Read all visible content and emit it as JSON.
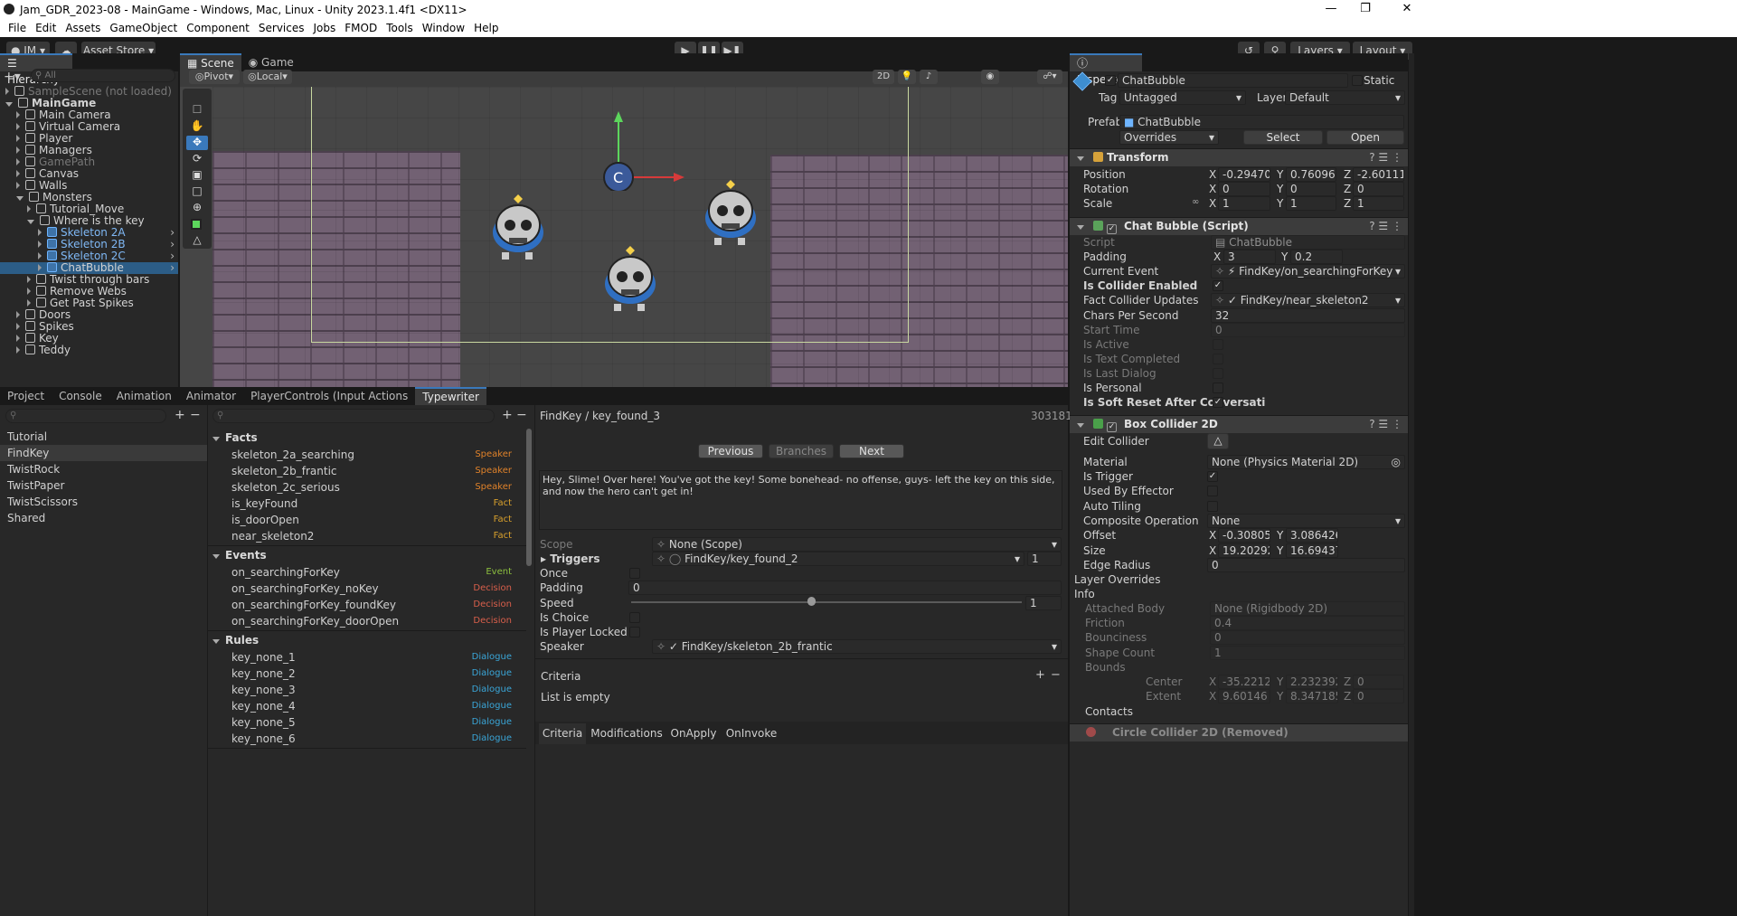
{
  "window": {
    "title": "Jam_GDR_2023-08 - MainGame - Windows, Mac, Linux - Unity 2023.1.4f1 <DX11>"
  },
  "menu": [
    "File",
    "Edit",
    "Assets",
    "GameObject",
    "Component",
    "Services",
    "Jobs",
    "FMOD",
    "Tools",
    "Window",
    "Help"
  ],
  "toolbar": {
    "account": "JM",
    "asset_store": "Asset Store",
    "layers": "Layers",
    "layout": "Layout"
  },
  "hierarchy": {
    "tab": "Hierarchy",
    "search_placeholder": "All",
    "items": [
      {
        "label": "SampleScene (not loaded)",
        "depth": 0,
        "dim": true
      },
      {
        "label": "MainGame",
        "depth": 0,
        "bold": true
      },
      {
        "label": "Main Camera",
        "depth": 1
      },
      {
        "label": "Virtual Camera",
        "depth": 1
      },
      {
        "label": "Player",
        "depth": 1
      },
      {
        "label": "Managers",
        "depth": 1
      },
      {
        "label": "GamePath",
        "depth": 1,
        "dim": true
      },
      {
        "label": "Canvas",
        "depth": 1
      },
      {
        "label": "Walls",
        "depth": 1
      },
      {
        "label": "Monsters",
        "depth": 1
      },
      {
        "label": "Tutorial_Move",
        "depth": 2
      },
      {
        "label": "Where is the key",
        "depth": 2
      },
      {
        "label": "Skeleton 2A",
        "depth": 3,
        "prefab": true
      },
      {
        "label": "Skeleton 2B",
        "depth": 3,
        "prefab": true
      },
      {
        "label": "Skeleton 2C",
        "depth": 3,
        "prefab": true
      },
      {
        "label": "ChatBubble",
        "depth": 3,
        "prefab": true,
        "selected": true
      },
      {
        "label": "Twist through bars",
        "depth": 2
      },
      {
        "label": "Remove Webs",
        "depth": 2
      },
      {
        "label": "Get Past Spikes",
        "depth": 2
      },
      {
        "label": "Doors",
        "depth": 1
      },
      {
        "label": "Spikes",
        "depth": 1
      },
      {
        "label": "Key",
        "depth": 1
      },
      {
        "label": "Teddy",
        "depth": 1
      }
    ]
  },
  "scene": {
    "tab_scene": "Scene",
    "tab_game": "Game",
    "pivot": "Pivot",
    "local": "Local",
    "mode_2d": "2D"
  },
  "bottom_tabs": [
    "Project",
    "Console",
    "Animation",
    "Animator",
    "PlayerControls (Input Actions",
    "Typewriter"
  ],
  "typewriter": {
    "categories": [
      "Tutorial",
      "FindKey",
      "TwistRock",
      "TwistPaper",
      "TwistScissors",
      "Shared"
    ],
    "selected_category": "FindKey",
    "facts_header": "Facts",
    "facts": [
      {
        "name": "skeleton_2a_searching",
        "kind": "Speaker"
      },
      {
        "name": "skeleton_2b_frantic",
        "kind": "Speaker"
      },
      {
        "name": "skeleton_2c_serious",
        "kind": "Speaker"
      },
      {
        "name": "is_keyFound",
        "kind": "Fact"
      },
      {
        "name": "is_doorOpen",
        "kind": "Fact"
      },
      {
        "name": "near_skeleton2",
        "kind": "Fact"
      }
    ],
    "events_header": "Events",
    "events": [
      {
        "name": "on_searchingForKey",
        "kind": "Event"
      },
      {
        "name": "on_searchingForKey_noKey",
        "kind": "Decision"
      },
      {
        "name": "on_searchingForKey_foundKey",
        "kind": "Decision"
      },
      {
        "name": "on_searchingForKey_doorOpen",
        "kind": "Decision"
      }
    ],
    "rules_header": "Rules",
    "rules": [
      {
        "name": "key_none_1",
        "kind": "Dialogue"
      },
      {
        "name": "key_none_2",
        "kind": "Dialogue"
      },
      {
        "name": "key_none_3",
        "kind": "Dialogue"
      },
      {
        "name": "key_none_4",
        "kind": "Dialogue"
      },
      {
        "name": "key_none_5",
        "kind": "Dialogue"
      },
      {
        "name": "key_none_6",
        "kind": "Dialogue"
      }
    ],
    "detail": {
      "path": "FindKey / key_found_3",
      "id": "303181",
      "prev": "Previous",
      "branches": "Branches",
      "next": "Next",
      "text": "Hey, Slime! Over here! You've got the key! Some bonehead- no offense, guys- left the key on this side, and now the hero can't get in!",
      "scope_label": "Scope",
      "scope_value": "None (Scope)",
      "triggers_label": "Triggers",
      "triggers_value": "FindKey/key_found_2",
      "triggers_count": "1",
      "once_label": "Once",
      "padding_label": "Padding",
      "padding_value": "0",
      "speed_label": "Speed",
      "speed_value": "1",
      "speed_level": 0.46,
      "is_choice_label": "Is Choice",
      "player_locked_label": "Is Player Locked",
      "speaker_label": "Speaker",
      "speaker_value": "FindKey/skeleton_2b_frantic",
      "criteria_label": "Criteria",
      "criteria_empty": "List is empty",
      "subtabs": [
        "Criteria",
        "Modifications",
        "OnApply",
        "OnInvoke"
      ]
    }
  },
  "inspector": {
    "tab": "Inspector",
    "object_name": "ChatBubble",
    "static_label": "Static",
    "tag_label": "Tag",
    "tag_value": "Untagged",
    "layer_label": "Layer",
    "layer_value": "Default",
    "prefab_label": "Prefab",
    "prefab_value": "ChatBubble",
    "overrides": "Overrides",
    "select": "Select",
    "open": "Open",
    "transform": {
      "header": "Transform",
      "position_label": "Position",
      "pos_x": "-0.294709",
      "pos_y": "0.7609673",
      "pos_z": "-2.601112",
      "rotation_label": "Rotation",
      "rot_x": "0",
      "rot_y": "0",
      "rot_z": "0",
      "scale_label": "Scale",
      "scl_x": "1",
      "scl_y": "1",
      "scl_z": "1"
    },
    "chat_bubble": {
      "header": "Chat Bubble (Script)",
      "script_label": "Script",
      "script_value": "ChatBubble",
      "padding_label": "Padding",
      "pad_x": "3",
      "pad_y": "0.2",
      "current_event_label": "Current Event",
      "current_event_value": "FindKey/on_searchingForKey",
      "collider_enabled_label": "Is Collider Enabled",
      "fact_collider_label": "Fact Collider Updates",
      "fact_collider_value": "FindKey/near_skeleton2",
      "chars_label": "Chars Per Second",
      "chars_value": "32",
      "start_time_label": "Start Time",
      "start_time_value": "0",
      "is_active_label": "Is Active",
      "text_completed_label": "Is Text Completed",
      "last_dialog_label": "Is Last Dialog",
      "personal_label": "Is Personal",
      "soft_reset_label": "Is Soft Reset After Conversati"
    },
    "box_collider": {
      "header": "Box Collider 2D",
      "edit_collider_label": "Edit Collider",
      "material_label": "Material",
      "material_value": "None (Physics Material 2D)",
      "trigger_label": "Is Trigger",
      "effector_label": "Used By Effector",
      "tiling_label": "Auto Tiling",
      "composite_label": "Composite Operation",
      "composite_value": "None",
      "offset_label": "Offset",
      "off_x": "-0.308052",
      "off_y": "3.086426",
      "size_label": "Size",
      "size_x": "19.20292",
      "size_y": "16.69437",
      "edge_label": "Edge Radius",
      "edge_value": "0",
      "layer_overrides": "Layer Overrides",
      "info": "Info",
      "attached_label": "Attached Body",
      "attached_value": "None (Rigidbody 2D)",
      "friction_label": "Friction",
      "friction_value": "0.4",
      "bounciness_label": "Bounciness",
      "bounciness_value": "0",
      "shape_label": "Shape Count",
      "shape_value": "1",
      "bounds_label": "Bounds",
      "center_label": "Center",
      "c_x": "-35.22127",
      "c_y": "2.232392",
      "c_z": "0",
      "extent_label": "Extent",
      "e_x": "9.60146",
      "e_y": "8.347185",
      "e_z": "0",
      "contacts": "Contacts"
    },
    "circle_removed": "Circle Collider 2D (Removed)"
  },
  "colors": {
    "speaker": "#e0822a",
    "fact": "#d8a02c",
    "event": "#8cbf3f",
    "decision": "#d95f4b",
    "dialogue": "#3aa6d8",
    "selection": "#2c5d87",
    "accent": "#3a79bb"
  }
}
